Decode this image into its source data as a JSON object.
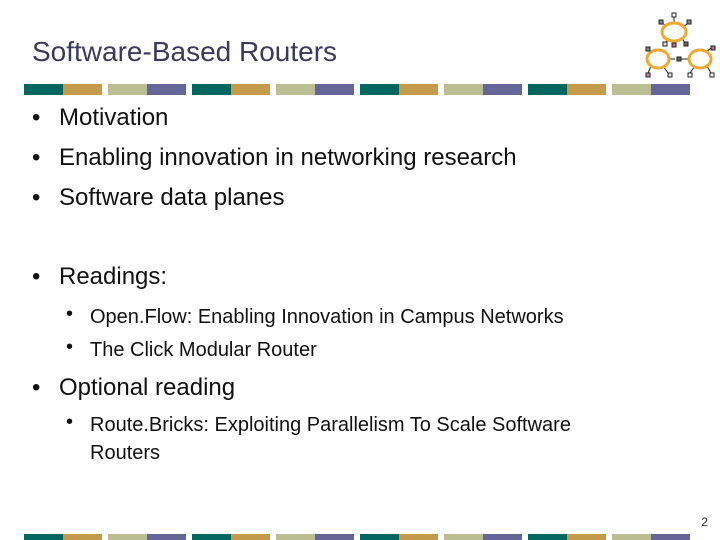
{
  "slide": {
    "title": "Software-Based Routers",
    "page_number": "2",
    "bullet_char": "•",
    "bullets": [
      {
        "text": "Motivation"
      },
      {
        "text": "Enabling innovation in networking research"
      },
      {
        "text": "Software data planes"
      },
      {
        "text": "Readings:"
      },
      {
        "text": "Optional reading"
      }
    ],
    "readings": [
      {
        "text": "Open.Flow: Enabling Innovation in Campus Networks"
      },
      {
        "text": "The Click Modular Router"
      }
    ],
    "optional_readings": [
      {
        "line1": "Route.Bricks: Exploiting Parallelism To Scale Software",
        "line2": "Routers"
      }
    ]
  },
  "theme": {
    "stripe_colors": [
      "#036660",
      "#c49b4b",
      "#bbbd93",
      "#656598"
    ],
    "title_color": "#3b3a5a",
    "logo_ring_color": "#f0a830"
  }
}
